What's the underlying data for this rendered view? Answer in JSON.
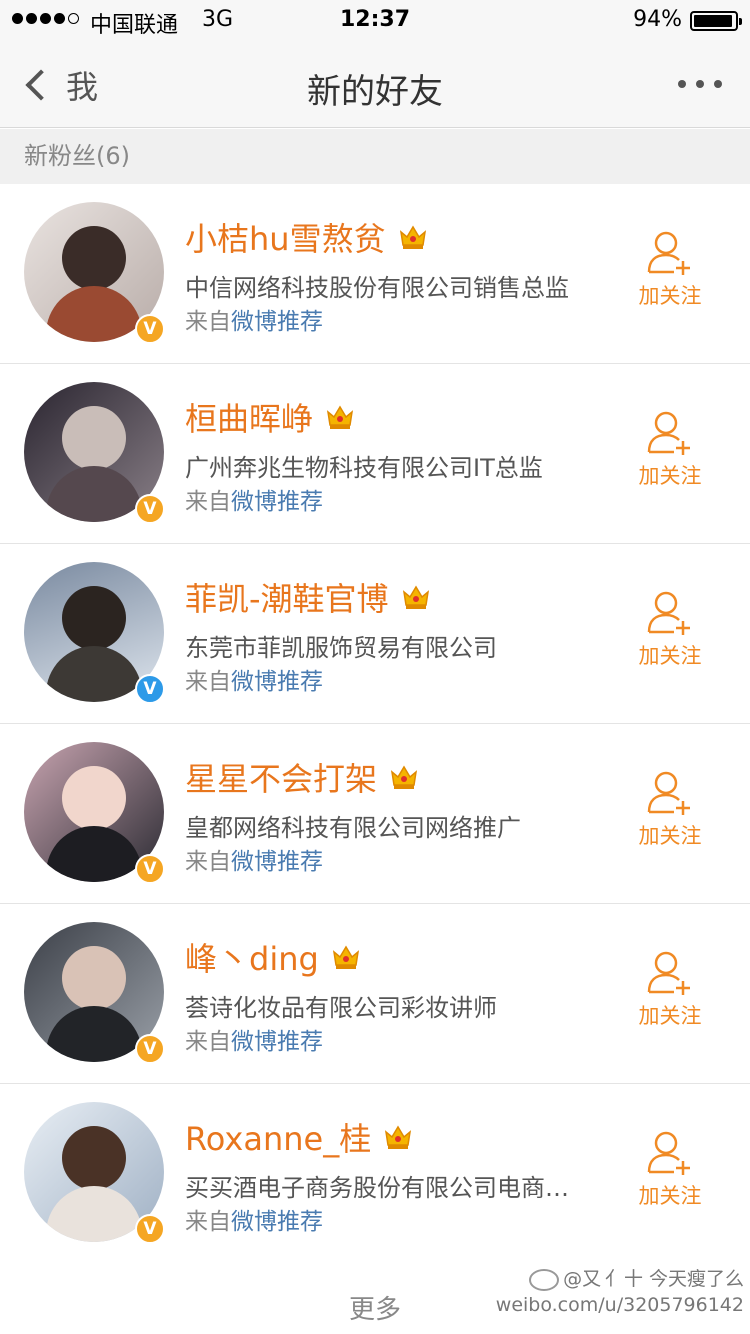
{
  "status_bar": {
    "carrier": "中国联通",
    "network": "3G",
    "time": "12:37",
    "battery": "94%",
    "battery_level": 0.94
  },
  "nav": {
    "back_label": "我",
    "title": "新的好友"
  },
  "section": {
    "header": "新粉丝(6)"
  },
  "friends": [
    {
      "name": "小桔hu雪熬贫",
      "description": "中信网络科技股份有限公司销售总监",
      "source_prefix": "来自",
      "source_link": "微博推荐",
      "follow_label": "加关注",
      "badge": "V",
      "badge_color": "#f5a623"
    },
    {
      "name": "桓曲晖峥",
      "description": "广州奔兆生物科技有限公司IT总监",
      "source_prefix": "来自",
      "source_link": "微博推荐",
      "follow_label": "加关注",
      "badge": "V",
      "badge_color": "#f5a623"
    },
    {
      "name": "菲凯-潮鞋官博",
      "description": "东莞市菲凯服饰贸易有限公司",
      "source_prefix": "来自",
      "source_link": "微博推荐",
      "follow_label": "加关注",
      "badge": "V",
      "badge_color": "#2d9ae8"
    },
    {
      "name": "星星不会打架",
      "description": "皇都网络科技有限公司网络推广",
      "source_prefix": "来自",
      "source_link": "微博推荐",
      "follow_label": "加关注",
      "badge": "V",
      "badge_color": "#f5a623"
    },
    {
      "name": "峰丶ding",
      "description": "荟诗化妆品有限公司彩妆讲师",
      "source_prefix": "来自",
      "source_link": "微博推荐",
      "follow_label": "加关注",
      "badge": "V",
      "badge_color": "#f5a623"
    },
    {
      "name": "Roxanne_桂",
      "description": "买买酒电子商务股份有限公司电商…",
      "source_prefix": "来自",
      "source_link": "微博推荐",
      "follow_label": "加关注",
      "badge": "V",
      "badge_color": "#f5a623"
    }
  ],
  "more_label": "更多",
  "watermark": {
    "line1": "@又 亻十  今天瘦了么",
    "line2": "weibo.com/u/3205796142"
  },
  "colors": {
    "accent": "#e8761d",
    "follow": "#f08a24",
    "link": "#4a7bb0"
  }
}
